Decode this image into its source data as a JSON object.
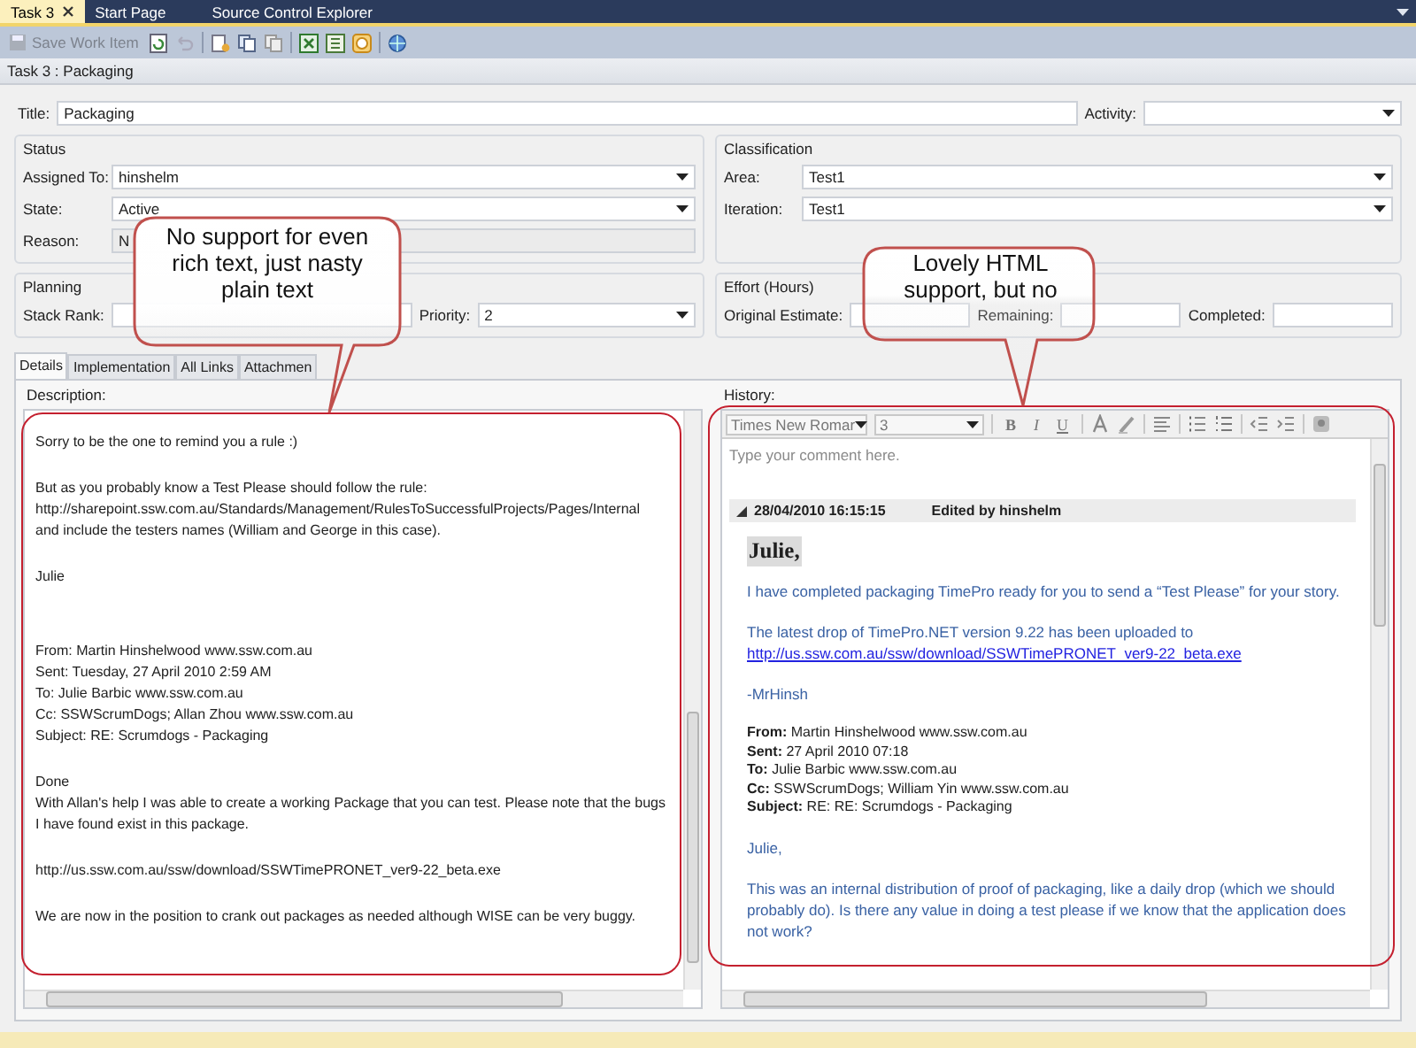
{
  "document_tabs": [
    {
      "label": "Task 3",
      "selected": true,
      "closable": true
    },
    {
      "label": "Start Page",
      "selected": false,
      "closable": false
    },
    {
      "label": "Source Control Explorer",
      "selected": false,
      "closable": false
    }
  ],
  "toolbar": {
    "save_button": {
      "label": "Save Work Item",
      "disabled": true
    }
  },
  "header": {
    "title": "Task 3 : Packaging"
  },
  "title_field": {
    "label": "Title:",
    "value": "Packaging"
  },
  "activity_field": {
    "label": "Activity:",
    "kind": "dropdown"
  },
  "status_group": {
    "title": "Status",
    "fields": [
      {
        "label": "Assigned To:",
        "value": "hinshelm",
        "kind": "dropdown"
      },
      {
        "label": "State:",
        "value": "Active",
        "kind": "dropdown"
      },
      {
        "label": "Reason:",
        "value": "N",
        "kind": "readonly"
      }
    ]
  },
  "classification_group": {
    "title": "Classification",
    "fields": [
      {
        "label": "Area:",
        "value": "Test1",
        "kind": "dropdown"
      },
      {
        "label": "Iteration:",
        "value": "Test1",
        "kind": "dropdown"
      }
    ]
  },
  "planning_group": {
    "title": "Planning",
    "fields": [
      {
        "label": "Stack Rank:",
        "kind": "text"
      },
      {
        "label": "Priority:",
        "value": "2",
        "kind": "dropdown"
      }
    ]
  },
  "effort_group": {
    "title": "Effort (Hours)",
    "fields": [
      {
        "label": "Original Estimate:",
        "kind": "text"
      },
      {
        "label": "Remaining:",
        "kind": "text"
      },
      {
        "label": "Completed:",
        "kind": "text"
      }
    ]
  },
  "detail_tabs": [
    {
      "label": "Details",
      "selected": true
    },
    {
      "label": "Implementation",
      "selected": false
    },
    {
      "label": "All Links",
      "selected": false
    },
    {
      "label": "Attachmen",
      "selected": false
    }
  ],
  "description": {
    "label": "Description:",
    "blocks": [
      [
        "Sorry to be the one to remind you a rule :)"
      ],
      [
        "But as you probably know a Test Please should follow the rule:",
        "http://sharepoint.ssw.com.au/Standards/Management/RulesToSuccessfulProjects/Pages/Internal",
        "and include the testers names (William and George in this case)."
      ],
      [
        "Julie"
      ],
      [
        "From: Martin Hinshelwood www.ssw.com.au",
        "Sent: Tuesday, 27 April 2010 2:59 AM",
        "To: Julie Barbic www.ssw.com.au",
        "Cc: SSWScrumDogs; Allan Zhou www.ssw.com.au",
        "Subject: RE: Scrumdogs - Packaging"
      ],
      [
        "Done",
        " With Allan's help I was able to create a working Package that you can test. Please note that the bugs I have found exist in this package."
      ],
      [
        "http://us.ssw.com.au/ssw/download/SSWTimePRONET_ver9-22_beta.exe"
      ],
      [
        "We are now in the position to crank out packages as needed although WISE can be very buggy."
      ]
    ]
  },
  "history": {
    "label": "History:",
    "font": "Times New Romar",
    "size": "3",
    "format_buttons": [
      "B",
      "I",
      "U"
    ],
    "placeholder": "Type your comment here.",
    "entries": [
      {
        "date": "28/04/2010 16:15:15",
        "editor": "Edited by hinshelm",
        "expanded": true,
        "greeting": "Julie,",
        "blocks": [
          {
            "kind": "text",
            "text": "  I have completed packaging TimePro ready for you to send a “Test Please” for your story."
          },
          {
            "kind": "text",
            "text": "The latest drop of TimePro.NET version 9.22 has been uploaded to",
            "link": "http://us.ssw.com.au/ssw/download/SSWTimePRONET_ver9-22_beta.exe"
          },
          {
            "kind": "text",
            "text": "-MrHinsh"
          },
          {
            "kind": "headers",
            "lines": [
              "**From:** Martin Hinshelwood www.ssw.com.au",
              "**Sent:** 27 April 2010 07:18",
              "**To:** Julie Barbic www.ssw.com.au",
              "**Cc:** SSWScrumDogs; William Yin www.ssw.com.au",
              "**Subject:** RE: RE: Scrumdogs - Packaging"
            ]
          },
          {
            "kind": "text",
            "text": "Julie,"
          },
          {
            "kind": "text",
            "text": "This was an internal distribution of proof of packaging, like a daily drop (which we should probably do). Is there any value in doing a test please if we know that the application does not work?"
          }
        ]
      }
    ]
  },
  "callouts": [
    {
      "text": "No support for even rich text, just nasty plain text"
    },
    {
      "text": "Lovely HTML support, but no"
    }
  ]
}
